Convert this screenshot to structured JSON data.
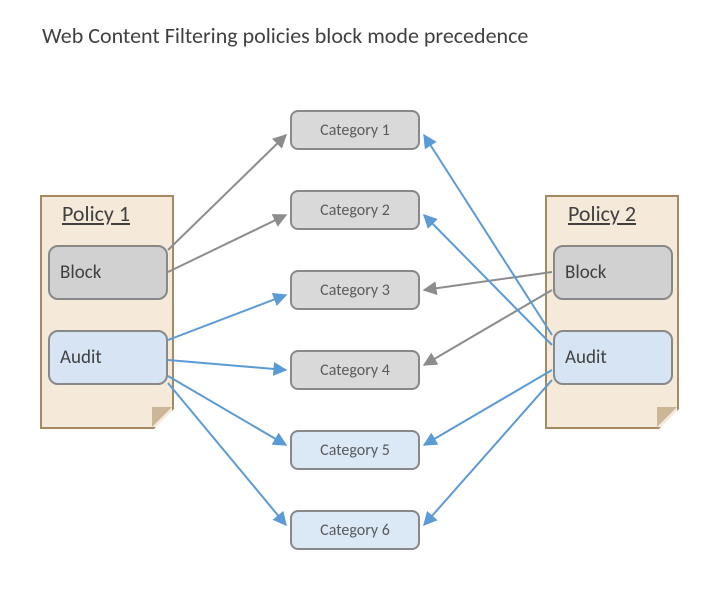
{
  "title": "Web Content Filtering policies block mode precedence",
  "policies": {
    "p1": {
      "title": "Policy 1",
      "block": "Block",
      "audit": "Audit"
    },
    "p2": {
      "title": "Policy 2",
      "block": "Block",
      "audit": "Audit"
    }
  },
  "categories": {
    "c1": "Category  1",
    "c2": "Category  2",
    "c3": "Category  3",
    "c4": "Category  4",
    "c5": "Category  5",
    "c6": "Category  6"
  },
  "colors": {
    "grayArrow": "#8c8c8c",
    "blueArrow": "#5b9bd5"
  }
}
